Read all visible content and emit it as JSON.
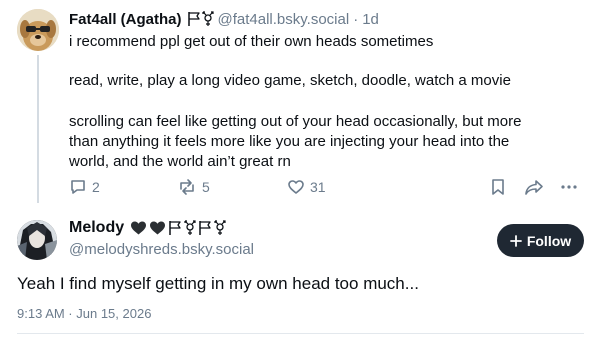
{
  "parent_post": {
    "author_name": "Fat4all (Agatha)",
    "author_handle": "@fat4all.bsky.social",
    "separator": "·",
    "time": "1d",
    "text_lines": [
      "i recommend ppl get out of their own heads sometimes",
      "read, write, play a long video game, sketch, doodle, watch a movie",
      "scrolling can feel like getting out of your head occasionally, but more",
      "than anything it feels more like you are injecting your head into the",
      "world, and the world ain’t great rn"
    ],
    "actions": {
      "reply_count": "2",
      "repost_count": "5",
      "like_count": "31"
    }
  },
  "main_post": {
    "author_name": "Melody",
    "author_handle": "@melodyshreds.bsky.social",
    "follow_label": "Follow",
    "text": "Yeah I find myself getting in my own head too much...",
    "meta": "9:13 AM · Jun 15, 2026"
  },
  "colors": {
    "text": "#0b0f14",
    "muted": "#6b7b8c",
    "thread_line": "#d4dbe2",
    "follow_bg": "#1f2833",
    "divider": "#e3e8ed"
  },
  "icons": [
    "flag-icon",
    "transgender-symbol-icon",
    "black-heart-icon",
    "reply-icon",
    "repost-icon",
    "like-icon",
    "bookmark-icon",
    "share-icon",
    "more-icon",
    "plus-icon"
  ]
}
